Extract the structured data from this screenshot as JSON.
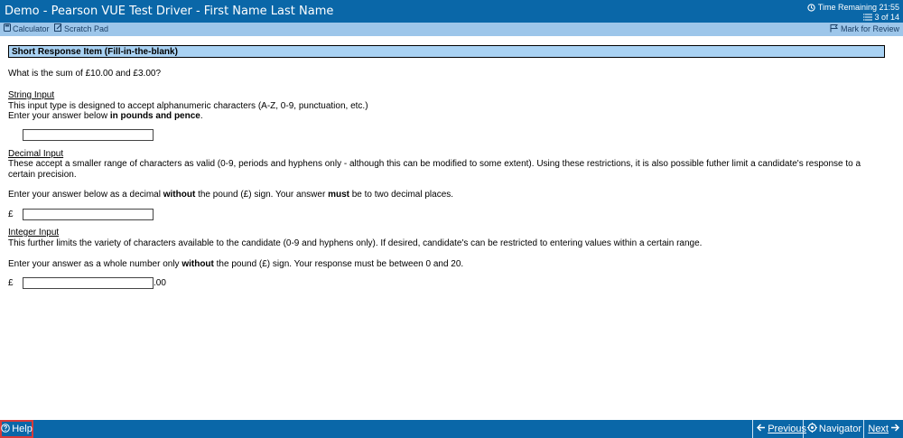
{
  "window": {
    "title": "Demo - Pearson VUE Test Driver - First Name Last Name",
    "time_remaining": "Time Remaining 21:55",
    "question_counter": "3 of 14"
  },
  "toolbar": {
    "calculator_label": "Calculator",
    "scratch_pad_label": "Scratch Pad",
    "mark_for_review_label": "Mark for Review"
  },
  "item": {
    "header": "Short Response Item (Fill-in-the-blank)",
    "question": "What is the sum of £10.00 and £3.00?",
    "string_input": {
      "title": "String Input",
      "description": "This input type is designed to accept alphanumeric characters (A-Z, 0-9, punctuation, etc.)",
      "instruction_prefix": "Enter your answer below ",
      "instruction_bold": "in pounds and pence",
      "instruction_suffix": ".",
      "value": ""
    },
    "decimal_input": {
      "title": "Decimal Input",
      "description": "These accept a smaller range of characters as valid (0-9, periods and hyphens only - although this can be modified to some extent). Using these restrictions, it is also possible futher limit a candidate's response to a certain precision.",
      "instruction_part1": "Enter your answer below as a decimal ",
      "instruction_bold1": "without",
      "instruction_part2": " the pound (£) sign. Your answer ",
      "instruction_bold2": "must",
      "instruction_part3": " be to two decimal places.",
      "currency_symbol": "£",
      "value": ""
    },
    "integer_input": {
      "title": "Integer Input",
      "description": "This further limits the variety of characters available to the candidate (0-9 and hyphens only). If desired, candidate's can be restricted to entering values within a certain range.",
      "instruction_part1": "Enter your answer as a whole number only ",
      "instruction_bold": "without",
      "instruction_part2": " the pound (£) sign. Your response must be between 0 and 20.",
      "currency_symbol": "£",
      "suffix": ".00",
      "value": ""
    }
  },
  "footer": {
    "help_label": "Help",
    "previous_label": "Previous",
    "navigator_label": "Navigator",
    "next_label": "Next"
  },
  "icons": {
    "clock": "clock-icon",
    "list": "question-list-icon",
    "calculator": "calculator-icon",
    "scratch_pad": "scratch-pad-icon",
    "flag": "flag-icon",
    "help": "help-icon",
    "previous": "arrow-left-icon",
    "navigator": "navigator-icon",
    "next": "arrow-right-icon"
  },
  "colors": {
    "title_bar": "#0a67a8",
    "toolbar": "#9dc6ea",
    "item_header": "#a9d2f3",
    "help_border": "#d83a3a"
  }
}
